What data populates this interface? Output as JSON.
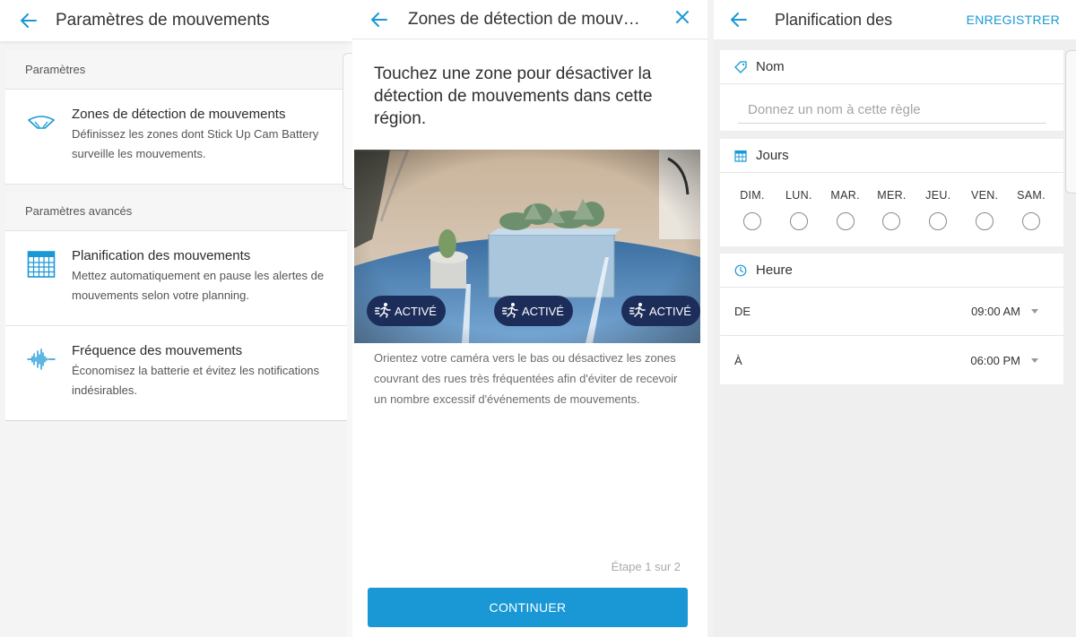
{
  "panel1": {
    "title": "Paramètres de mouvements",
    "section1": "Paramètres",
    "section2": "Paramètres avancés",
    "items": [
      {
        "title": "Zones de détection de mouvements",
        "desc": "Définissez les zones dont Stick Up Cam Battery surveille les mouvements.",
        "icon": "motion-zone-icon"
      },
      {
        "title": "Planification des mouvements",
        "desc": "Mettez automatiquement en pause les alertes de mouvements selon votre planning.",
        "icon": "calendar-icon"
      },
      {
        "title": "Fréquence des mouvements",
        "desc": "Économisez la batterie et évitez les notifications indésirables.",
        "icon": "frequency-wave-icon"
      }
    ]
  },
  "panel2": {
    "title": "Zones de détection de mouvements",
    "instruction": "Touchez une zone pour désactiver la détection de mouvements dans cette région.",
    "zones": [
      {
        "label": "ACTIVÉ"
      },
      {
        "label": "ACTIVÉ"
      },
      {
        "label": "ACTIVÉ"
      }
    ],
    "help": "Orientez votre caméra vers le bas ou désactivez les zones couvrant des rues très fréquentées afin d'éviter de recevoir un nombre excessif d'événements de mouvements.",
    "step": "Étape 1 sur 2",
    "continue_label": "CONTINUER",
    "accent": "#1998d5",
    "badge_color": "#1c2d5a"
  },
  "panel3": {
    "title": "Planification des",
    "save_label": "ENREGISTRER",
    "name_section": "Nom",
    "name_placeholder": "Donnez un nom à cette règle",
    "days_section": "Jours",
    "days": [
      "DIM.",
      "LUN.",
      "MAR.",
      "MER.",
      "JEU.",
      "VEN.",
      "SAM."
    ],
    "time_section": "Heure",
    "from_label": "DE",
    "from_value": "09:00 AM",
    "to_label": "À",
    "to_value": "06:00 PM"
  }
}
